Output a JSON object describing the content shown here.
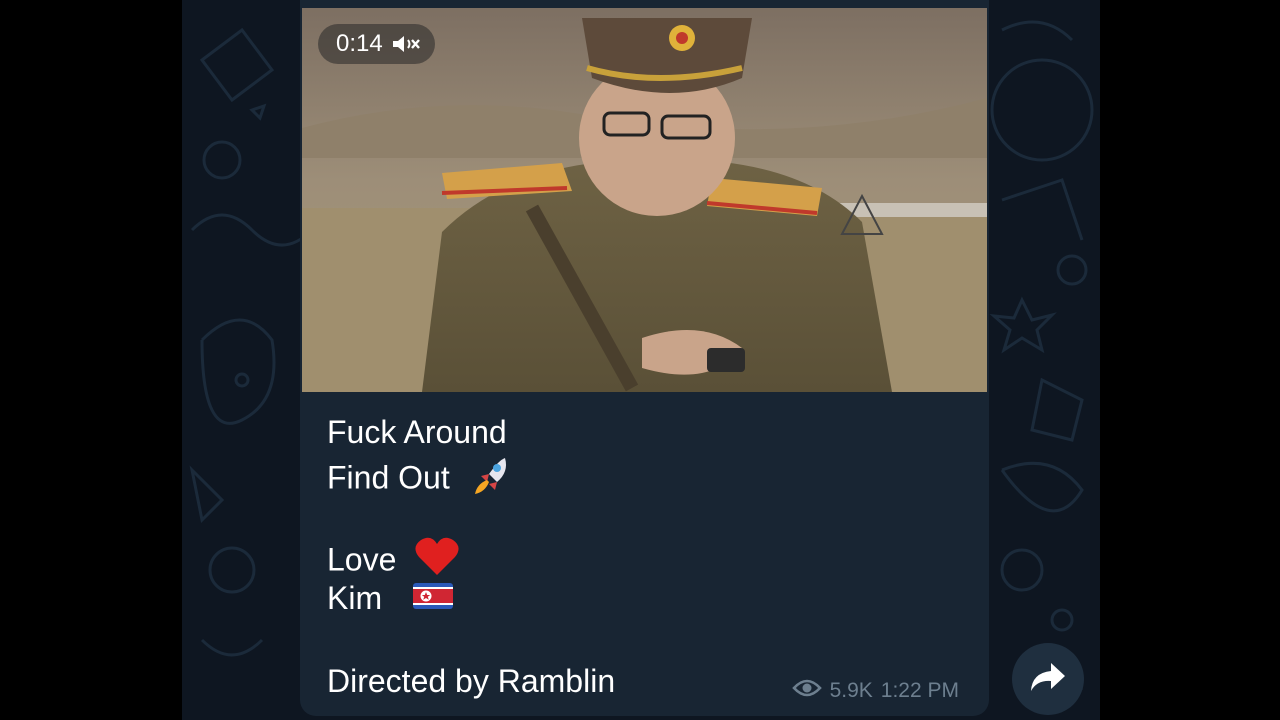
{
  "video": {
    "duration": "0:14",
    "muted_icon": "speaker-muted-icon"
  },
  "caption": {
    "line1": "Fuck Around",
    "line2": "Find Out",
    "line2_emoji": "rocket-emoji",
    "line4": "Love",
    "line4_emoji": "red-heart-emoji",
    "line5": "Kim",
    "line5_emoji": "north-korea-flag-emoji",
    "line7": "Directed by Ramblin"
  },
  "meta": {
    "views": "5.9K",
    "time": "1:22 PM",
    "views_icon": "eye-icon"
  },
  "actions": {
    "share_icon": "share-arrow-icon"
  },
  "colors": {
    "chat_background": "#0e1621",
    "bubble": "#182533",
    "meta_text": "#6d7f8f",
    "share_button": "#1f2f3f"
  }
}
